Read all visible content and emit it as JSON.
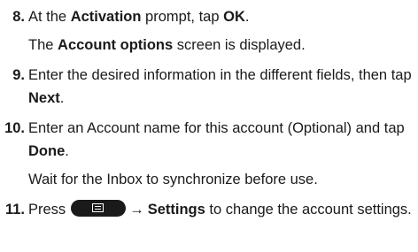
{
  "steps": [
    {
      "number": "8.",
      "pre": "At the ",
      "bold": "Activation",
      "post": " prompt, tap ",
      "bold2": "OK",
      "end": ".",
      "sub_pre": "The ",
      "sub_bold": "Account options",
      "sub_post": " screen is displayed."
    },
    {
      "number": "9.",
      "text": "Enter the desired information in the different fields, then tap ",
      "bold": "Next",
      "end": "."
    },
    {
      "number": "10.",
      "text": "Enter an Account name for this account (Optional) and tap ",
      "bold": "Done",
      "end": ".",
      "sub": "Wait for the Inbox to synchronize before use."
    },
    {
      "number": "11.",
      "pre": "Press",
      "key_icon": "menu-key-icon",
      "arrow": "→",
      "bold": "Settings",
      "post": " to change the account settings."
    }
  ]
}
